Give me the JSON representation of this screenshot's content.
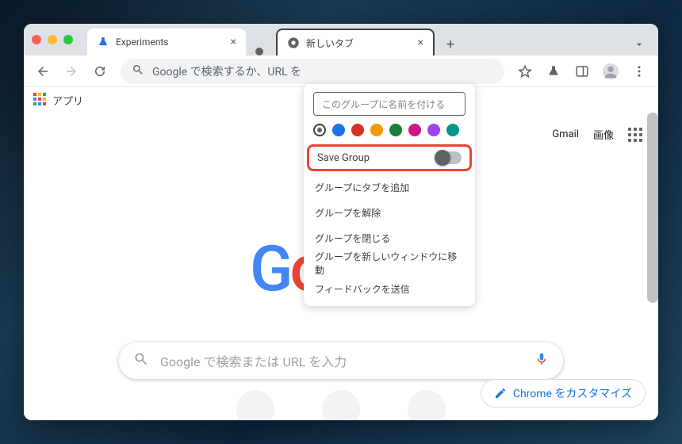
{
  "tabs": {
    "first": {
      "title": "Experiments"
    },
    "second": {
      "title": "新しいタブ"
    }
  },
  "toolbar": {
    "omnibox_placeholder": "Google で検索するか、URL を"
  },
  "bookmarks": {
    "apps": "アプリ"
  },
  "toplinks": {
    "gmail": "Gmail",
    "images": "画像"
  },
  "search": {
    "placeholder": "Google で検索または URL を入力"
  },
  "customize": {
    "label": "Chrome をカスタマイズ"
  },
  "group_popover": {
    "name_placeholder": "このグループに名前を付ける",
    "colors": [
      "#5f6368",
      "#1a73e8",
      "#d93025",
      "#f29900",
      "#188038",
      "#d01884",
      "#a142f4",
      "#009688"
    ],
    "save_group": "Save Group",
    "add_tab": "グループにタブを追加",
    "ungroup": "グループを解除",
    "close_group": "グループを閉じる",
    "move_window": "グループを新しいウィンドウに移動",
    "feedback": "フィードバックを送信"
  }
}
